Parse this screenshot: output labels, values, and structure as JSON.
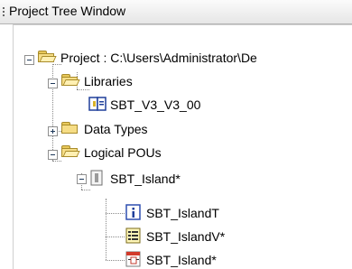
{
  "window": {
    "title": "Project Tree Window"
  },
  "tree": {
    "project": {
      "label": "Project : C:\\Users\\Administrator\\De",
      "icon": "open-folder-icon"
    },
    "libraries": {
      "label": "Libraries",
      "icon": "open-folder-icon"
    },
    "library_item": {
      "label": "SBT_V3_V3_00",
      "icon": "library-book-icon"
    },
    "data_types": {
      "label": "Data Types",
      "icon": "folder-icon"
    },
    "logical_pous": {
      "label": "Logical POUs",
      "icon": "open-folder-icon"
    },
    "pou": {
      "label": "SBT_Island*",
      "icon": "pou-module-icon"
    },
    "children": [
      {
        "label": "SBT_IslandT",
        "icon": "info-header-icon"
      },
      {
        "label": "SBT_IslandV*",
        "icon": "variables-list-icon"
      },
      {
        "label": "SBT_Island*",
        "icon": "function-block-body-icon"
      }
    ]
  }
}
